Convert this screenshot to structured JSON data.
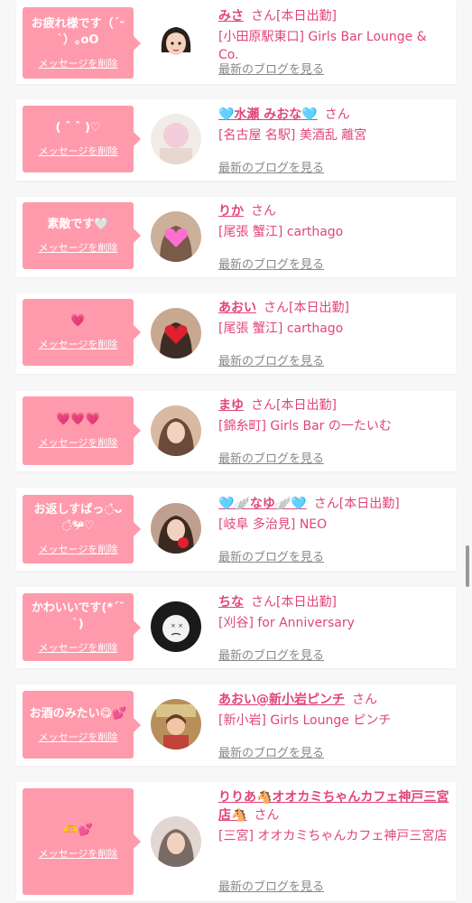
{
  "delete_label": "メッセージを削除",
  "blog_label": "最新のブログを見る",
  "san": "さん",
  "colors": {
    "bubble": "#ff9aac",
    "name": "#e0457b",
    "blog": "#888888",
    "background": "#f7f7f7"
  },
  "items": [
    {
      "message": "お疲れ様です（ˊᵕˋ）｡oO",
      "name": "みさ",
      "status": "[本日出勤]",
      "shop": "[小田原駅東口] Girls Bar Lounge & Co.",
      "avatar": "anime-girl-avatar"
    },
    {
      "message": "( ˆ ˆ )♡",
      "name": "🩵水瀬 みおな🩵",
      "status": "",
      "shop": "[名古屋 名駅] 美酒乱 離宮",
      "avatar": "blurred-photo-avatar"
    },
    {
      "message": "素敵です🤍",
      "name": "りか",
      "status": "",
      "shop": "[尾張 蟹江] carthago",
      "avatar": "heart-covered-photo-avatar"
    },
    {
      "message": "💗",
      "name": "あおい",
      "status": "[本日出勤]",
      "shop": "[尾張 蟹江] carthago",
      "avatar": "heart-covered-photo-avatar"
    },
    {
      "message": "💗💗💗",
      "name": "まゆ",
      "status": "[本日出勤]",
      "shop": "[錦糸町] Girls Bar の一たいむ",
      "avatar": "photo-avatar"
    },
    {
      "message": "お返しすぱっ◌̇ᴗ◌̇*ᵒ̴̶̷♡",
      "name": "🩵🪽なゆ🪽🩵",
      "status": "[本日出勤]",
      "shop": "[岐阜 多治見] NEO",
      "avatar": "photo-avatar"
    },
    {
      "message": "かわいいです(*´˘`)",
      "name": "ちな",
      "status": "[本日出勤]",
      "shop": "[刈谷] for Anniversary",
      "avatar": "sticker-face-avatar"
    },
    {
      "message": "お酒のみたい😋💕",
      "name": "あおい@新小岩ピンチ",
      "status": "",
      "shop": "[新小岩] Girls Lounge ピンチ",
      "avatar": "illustration-avatar"
    },
    {
      "message": "🫶💕",
      "name": "りりあ🐴オオカミちゃんカフェ神戸三宮店🐴",
      "status": "",
      "shop": "[三宮] オオカミちゃんカフェ神戸三宮店",
      "avatar": "photo-avatar"
    }
  ]
}
